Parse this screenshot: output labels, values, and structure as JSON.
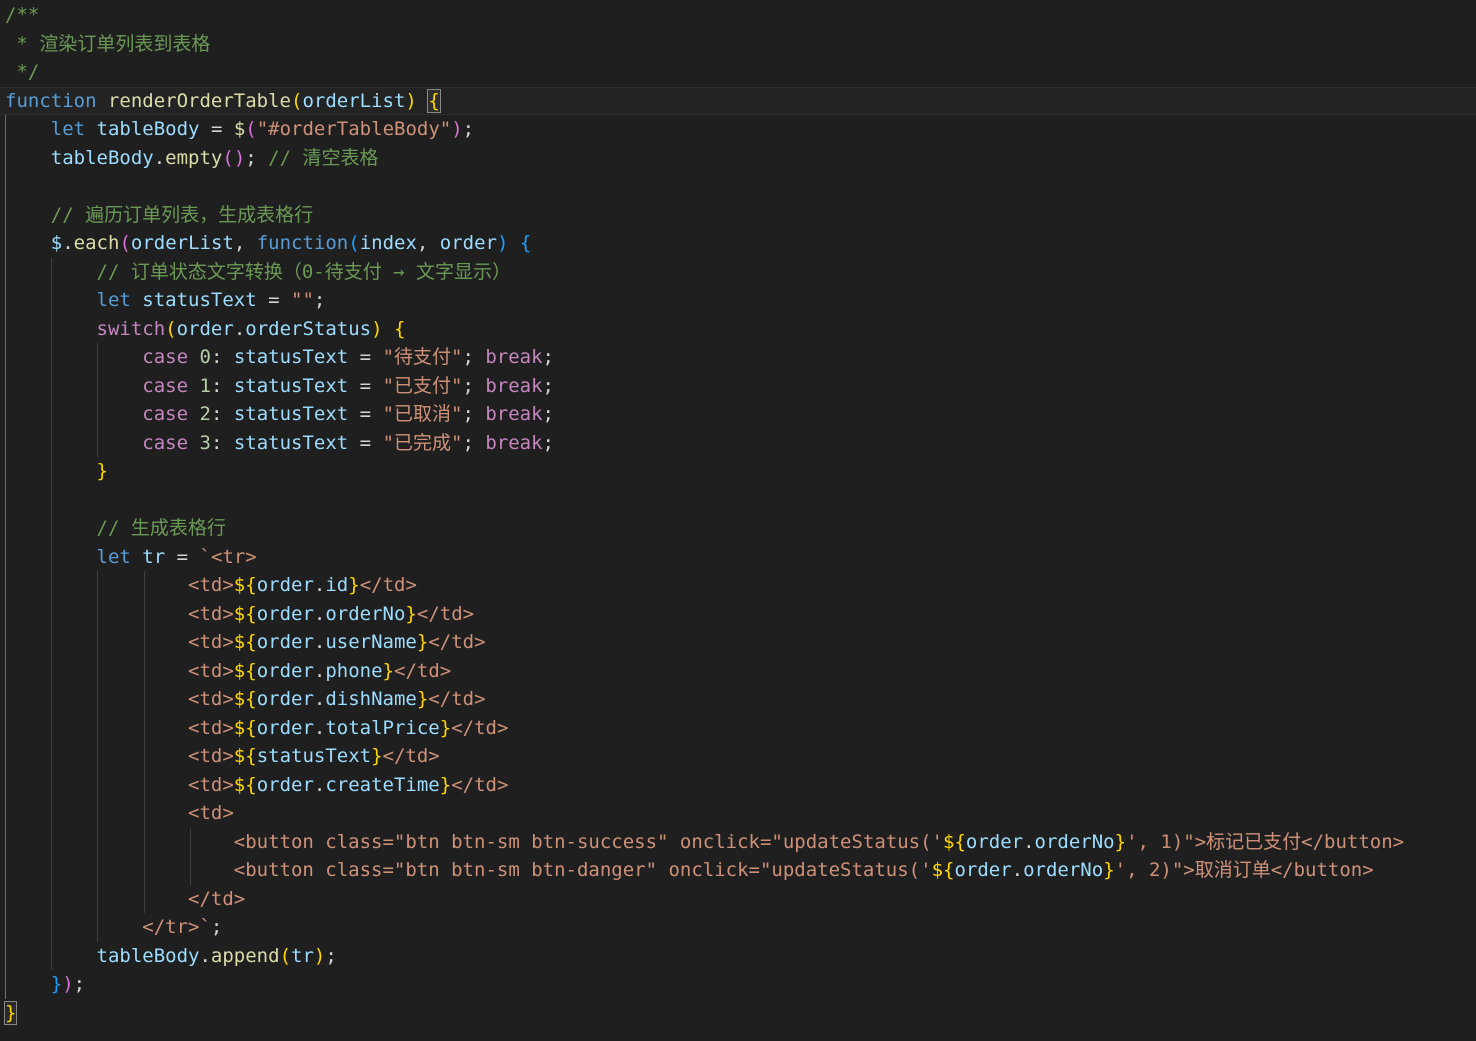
{
  "editor": {
    "language": "javascript",
    "theme_colors": {
      "background": "#1f1f1f",
      "comment": "#6a9955",
      "keyword": "#569cd6",
      "control": "#c586c0",
      "function": "#dcdcaa",
      "variable": "#9cdcfe",
      "string": "#ce9178",
      "number": "#b5cea8",
      "bracket_gold": "#ffd700",
      "bracket_orchid": "#da70d6",
      "bracket_blue": "#179fff"
    },
    "lines": [
      [
        [
          "c-comment",
          "/**"
        ]
      ],
      [
        [
          "c-comment",
          " * 渲染订单列表到表格"
        ]
      ],
      [
        [
          "c-comment",
          " */"
        ]
      ],
      [
        [
          "c-keyword",
          "function"
        ],
        [
          "c-punc",
          " "
        ],
        [
          "c-func",
          "renderOrderTable"
        ],
        [
          "c-b1",
          "("
        ],
        [
          "c-var",
          "orderList"
        ],
        [
          "c-b1",
          ")"
        ],
        [
          "c-punc",
          " "
        ],
        [
          "c-b1 bracket-match",
          "{"
        ]
      ],
      [
        [
          "c-punc",
          "    "
        ],
        [
          "c-keyword",
          "let"
        ],
        [
          "c-punc",
          " "
        ],
        [
          "c-var",
          "tableBody"
        ],
        [
          "c-punc",
          " = "
        ],
        [
          "c-func",
          "$"
        ],
        [
          "c-b2",
          "("
        ],
        [
          "c-str",
          "\"#orderTableBody\""
        ],
        [
          "c-b2",
          ")"
        ],
        [
          "c-punc",
          ";"
        ]
      ],
      [
        [
          "c-punc",
          "    "
        ],
        [
          "c-var",
          "tableBody"
        ],
        [
          "c-punc",
          "."
        ],
        [
          "c-func",
          "empty"
        ],
        [
          "c-b2",
          "()"
        ],
        [
          "c-punc",
          "; "
        ],
        [
          "c-comment",
          "// 清空表格"
        ]
      ],
      [],
      [
        [
          "c-punc",
          "    "
        ],
        [
          "c-comment",
          "// 遍历订单列表，生成表格行"
        ]
      ],
      [
        [
          "c-punc",
          "    "
        ],
        [
          "c-var",
          "$"
        ],
        [
          "c-punc",
          "."
        ],
        [
          "c-func",
          "each"
        ],
        [
          "c-b2",
          "("
        ],
        [
          "c-var",
          "orderList"
        ],
        [
          "c-punc",
          ", "
        ],
        [
          "c-keyword",
          "function"
        ],
        [
          "c-b3",
          "("
        ],
        [
          "c-var",
          "index"
        ],
        [
          "c-punc",
          ", "
        ],
        [
          "c-var",
          "order"
        ],
        [
          "c-b3",
          ")"
        ],
        [
          "c-punc",
          " "
        ],
        [
          "c-b3",
          "{"
        ]
      ],
      [
        [
          "c-punc",
          "        "
        ],
        [
          "c-comment",
          "// 订单状态文字转换（0-待支付 → 文字显示）"
        ]
      ],
      [
        [
          "c-punc",
          "        "
        ],
        [
          "c-keyword",
          "let"
        ],
        [
          "c-punc",
          " "
        ],
        [
          "c-var",
          "statusText"
        ],
        [
          "c-punc",
          " = "
        ],
        [
          "c-str",
          "\"\""
        ],
        [
          "c-punc",
          ";"
        ]
      ],
      [
        [
          "c-punc",
          "        "
        ],
        [
          "c-control",
          "switch"
        ],
        [
          "c-b1",
          "("
        ],
        [
          "c-var",
          "order"
        ],
        [
          "c-punc",
          "."
        ],
        [
          "c-var",
          "orderStatus"
        ],
        [
          "c-b1",
          ")"
        ],
        [
          "c-punc",
          " "
        ],
        [
          "c-b1",
          "{"
        ]
      ],
      [
        [
          "c-punc",
          "            "
        ],
        [
          "c-control",
          "case"
        ],
        [
          "c-punc",
          " "
        ],
        [
          "c-num",
          "0"
        ],
        [
          "c-punc",
          ": "
        ],
        [
          "c-var",
          "statusText"
        ],
        [
          "c-punc",
          " = "
        ],
        [
          "c-str",
          "\"待支付\""
        ],
        [
          "c-punc",
          "; "
        ],
        [
          "c-control",
          "break"
        ],
        [
          "c-punc",
          ";"
        ]
      ],
      [
        [
          "c-punc",
          "            "
        ],
        [
          "c-control",
          "case"
        ],
        [
          "c-punc",
          " "
        ],
        [
          "c-num",
          "1"
        ],
        [
          "c-punc",
          ": "
        ],
        [
          "c-var",
          "statusText"
        ],
        [
          "c-punc",
          " = "
        ],
        [
          "c-str",
          "\"已支付\""
        ],
        [
          "c-punc",
          "; "
        ],
        [
          "c-control",
          "break"
        ],
        [
          "c-punc",
          ";"
        ]
      ],
      [
        [
          "c-punc",
          "            "
        ],
        [
          "c-control",
          "case"
        ],
        [
          "c-punc",
          " "
        ],
        [
          "c-num",
          "2"
        ],
        [
          "c-punc",
          ": "
        ],
        [
          "c-var",
          "statusText"
        ],
        [
          "c-punc",
          " = "
        ],
        [
          "c-str",
          "\"已取消\""
        ],
        [
          "c-punc",
          "; "
        ],
        [
          "c-control",
          "break"
        ],
        [
          "c-punc",
          ";"
        ]
      ],
      [
        [
          "c-punc",
          "            "
        ],
        [
          "c-control",
          "case"
        ],
        [
          "c-punc",
          " "
        ],
        [
          "c-num",
          "3"
        ],
        [
          "c-punc",
          ": "
        ],
        [
          "c-var",
          "statusText"
        ],
        [
          "c-punc",
          " = "
        ],
        [
          "c-str",
          "\"已完成\""
        ],
        [
          "c-punc",
          "; "
        ],
        [
          "c-control",
          "break"
        ],
        [
          "c-punc",
          ";"
        ]
      ],
      [
        [
          "c-punc",
          "        "
        ],
        [
          "c-b1",
          "}"
        ]
      ],
      [],
      [
        [
          "c-punc",
          "        "
        ],
        [
          "c-comment",
          "// 生成表格行"
        ]
      ],
      [
        [
          "c-punc",
          "        "
        ],
        [
          "c-keyword",
          "let"
        ],
        [
          "c-punc",
          " "
        ],
        [
          "c-var",
          "tr"
        ],
        [
          "c-punc",
          " = "
        ],
        [
          "c-str",
          "`<tr>"
        ]
      ],
      [
        [
          "c-punc",
          "                "
        ],
        [
          "c-str",
          "<td>"
        ],
        [
          "c-interp",
          "${"
        ],
        [
          "c-var",
          "order"
        ],
        [
          "c-punc",
          "."
        ],
        [
          "c-var",
          "id"
        ],
        [
          "c-interp",
          "}"
        ],
        [
          "c-str",
          "</td>"
        ]
      ],
      [
        [
          "c-punc",
          "                "
        ],
        [
          "c-str",
          "<td>"
        ],
        [
          "c-interp",
          "${"
        ],
        [
          "c-var",
          "order"
        ],
        [
          "c-punc",
          "."
        ],
        [
          "c-var",
          "orderNo"
        ],
        [
          "c-interp",
          "}"
        ],
        [
          "c-str",
          "</td>"
        ]
      ],
      [
        [
          "c-punc",
          "                "
        ],
        [
          "c-str",
          "<td>"
        ],
        [
          "c-interp",
          "${"
        ],
        [
          "c-var",
          "order"
        ],
        [
          "c-punc",
          "."
        ],
        [
          "c-var",
          "userName"
        ],
        [
          "c-interp",
          "}"
        ],
        [
          "c-str",
          "</td>"
        ]
      ],
      [
        [
          "c-punc",
          "                "
        ],
        [
          "c-str",
          "<td>"
        ],
        [
          "c-interp",
          "${"
        ],
        [
          "c-var",
          "order"
        ],
        [
          "c-punc",
          "."
        ],
        [
          "c-var",
          "phone"
        ],
        [
          "c-interp",
          "}"
        ],
        [
          "c-str",
          "</td>"
        ]
      ],
      [
        [
          "c-punc",
          "                "
        ],
        [
          "c-str",
          "<td>"
        ],
        [
          "c-interp",
          "${"
        ],
        [
          "c-var",
          "order"
        ],
        [
          "c-punc",
          "."
        ],
        [
          "c-var",
          "dishName"
        ],
        [
          "c-interp",
          "}"
        ],
        [
          "c-str",
          "</td>"
        ]
      ],
      [
        [
          "c-punc",
          "                "
        ],
        [
          "c-str",
          "<td>"
        ],
        [
          "c-interp",
          "${"
        ],
        [
          "c-var",
          "order"
        ],
        [
          "c-punc",
          "."
        ],
        [
          "c-var",
          "totalPrice"
        ],
        [
          "c-interp",
          "}"
        ],
        [
          "c-str",
          "</td>"
        ]
      ],
      [
        [
          "c-punc",
          "                "
        ],
        [
          "c-str",
          "<td>"
        ],
        [
          "c-interp",
          "${"
        ],
        [
          "c-var",
          "statusText"
        ],
        [
          "c-interp",
          "}"
        ],
        [
          "c-str",
          "</td>"
        ]
      ],
      [
        [
          "c-punc",
          "                "
        ],
        [
          "c-str",
          "<td>"
        ],
        [
          "c-interp",
          "${"
        ],
        [
          "c-var",
          "order"
        ],
        [
          "c-punc",
          "."
        ],
        [
          "c-var",
          "createTime"
        ],
        [
          "c-interp",
          "}"
        ],
        [
          "c-str",
          "</td>"
        ]
      ],
      [
        [
          "c-punc",
          "                "
        ],
        [
          "c-str",
          "<td>"
        ]
      ],
      [
        [
          "c-punc",
          "                    "
        ],
        [
          "c-str",
          "<button class=\"btn btn-sm btn-success\" onclick=\"updateStatus('"
        ],
        [
          "c-interp",
          "${"
        ],
        [
          "c-var",
          "order"
        ],
        [
          "c-punc",
          "."
        ],
        [
          "c-var",
          "orderNo"
        ],
        [
          "c-interp",
          "}"
        ],
        [
          "c-str",
          "', 1)\">标记已支付</button>"
        ]
      ],
      [
        [
          "c-punc",
          "                    "
        ],
        [
          "c-str",
          "<button class=\"btn btn-sm btn-danger\" onclick=\"updateStatus('"
        ],
        [
          "c-interp",
          "${"
        ],
        [
          "c-var",
          "order"
        ],
        [
          "c-punc",
          "."
        ],
        [
          "c-var",
          "orderNo"
        ],
        [
          "c-interp",
          "}"
        ],
        [
          "c-str",
          "', 2)\">取消订单</button>"
        ]
      ],
      [
        [
          "c-punc",
          "                "
        ],
        [
          "c-str",
          "</td>"
        ]
      ],
      [
        [
          "c-punc",
          "            "
        ],
        [
          "c-str",
          "</tr>`"
        ],
        [
          "c-punc",
          ";"
        ]
      ],
      [
        [
          "c-punc",
          "        "
        ],
        [
          "c-var",
          "tableBody"
        ],
        [
          "c-punc",
          "."
        ],
        [
          "c-func",
          "append"
        ],
        [
          "c-b1",
          "("
        ],
        [
          "c-var",
          "tr"
        ],
        [
          "c-b1",
          ")"
        ],
        [
          "c-punc",
          ";"
        ]
      ],
      [
        [
          "c-punc",
          "    "
        ],
        [
          "c-b3",
          "}"
        ],
        [
          "c-b2",
          ")"
        ],
        [
          "c-punc",
          ";"
        ]
      ],
      [
        [
          "c-b1 bracket-match",
          "}"
        ]
      ]
    ]
  }
}
